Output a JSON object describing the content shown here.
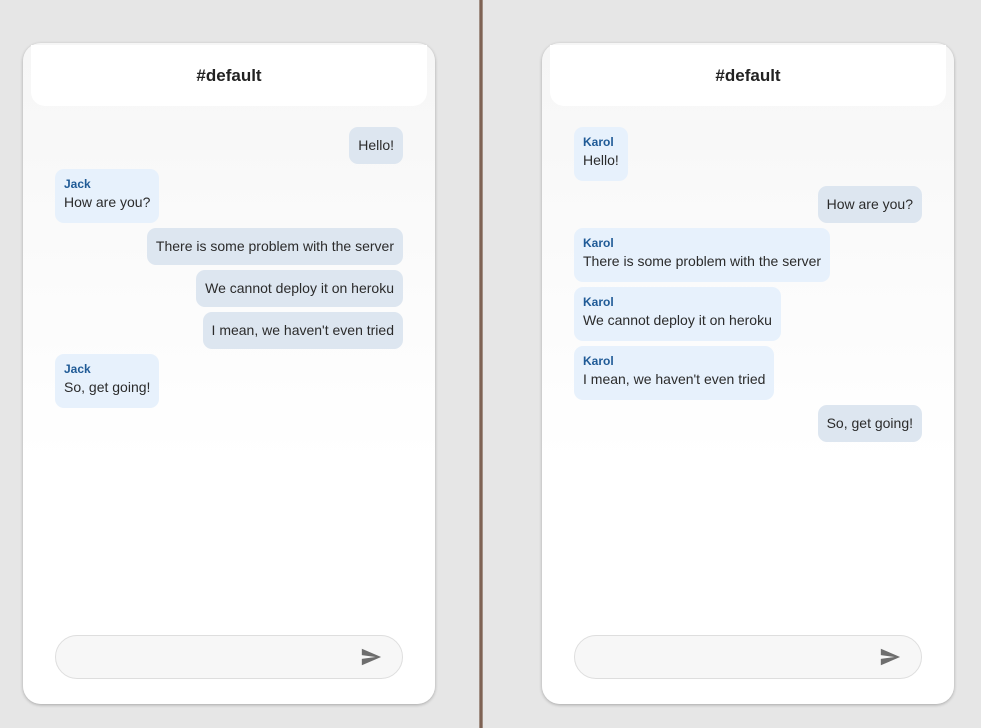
{
  "colors": {
    "outgoing_bubble": "#dde6f0",
    "incoming_bubble": "#e7f1fc",
    "sender_name": "#1f5a96",
    "send_icon": "#6e6e6e"
  },
  "icons": {
    "send": "send-icon"
  },
  "panels": [
    {
      "channel": "#default",
      "messages": [
        {
          "direction": "out",
          "sender": "",
          "text": "Hello!"
        },
        {
          "direction": "in",
          "sender": "Jack",
          "text": "How are you?"
        },
        {
          "direction": "out",
          "sender": "",
          "text": "There is some problem with the server"
        },
        {
          "direction": "out",
          "sender": "",
          "text": "We cannot deploy it on heroku"
        },
        {
          "direction": "out",
          "sender": "",
          "text": "I mean, we haven't even tried"
        },
        {
          "direction": "in",
          "sender": "Jack",
          "text": "So, get going!"
        }
      ],
      "input": {
        "value": "",
        "placeholder": ""
      }
    },
    {
      "channel": "#default",
      "messages": [
        {
          "direction": "in",
          "sender": "Karol",
          "text": "Hello!"
        },
        {
          "direction": "out",
          "sender": "",
          "text": "How are you?"
        },
        {
          "direction": "in",
          "sender": "Karol",
          "text": "There is some problem with the server"
        },
        {
          "direction": "in",
          "sender": "Karol",
          "text": "We cannot deploy it on heroku"
        },
        {
          "direction": "in",
          "sender": "Karol",
          "text": "I mean, we haven't even tried"
        },
        {
          "direction": "out",
          "sender": "",
          "text": "So, get going!"
        }
      ],
      "input": {
        "value": "",
        "placeholder": ""
      }
    }
  ]
}
